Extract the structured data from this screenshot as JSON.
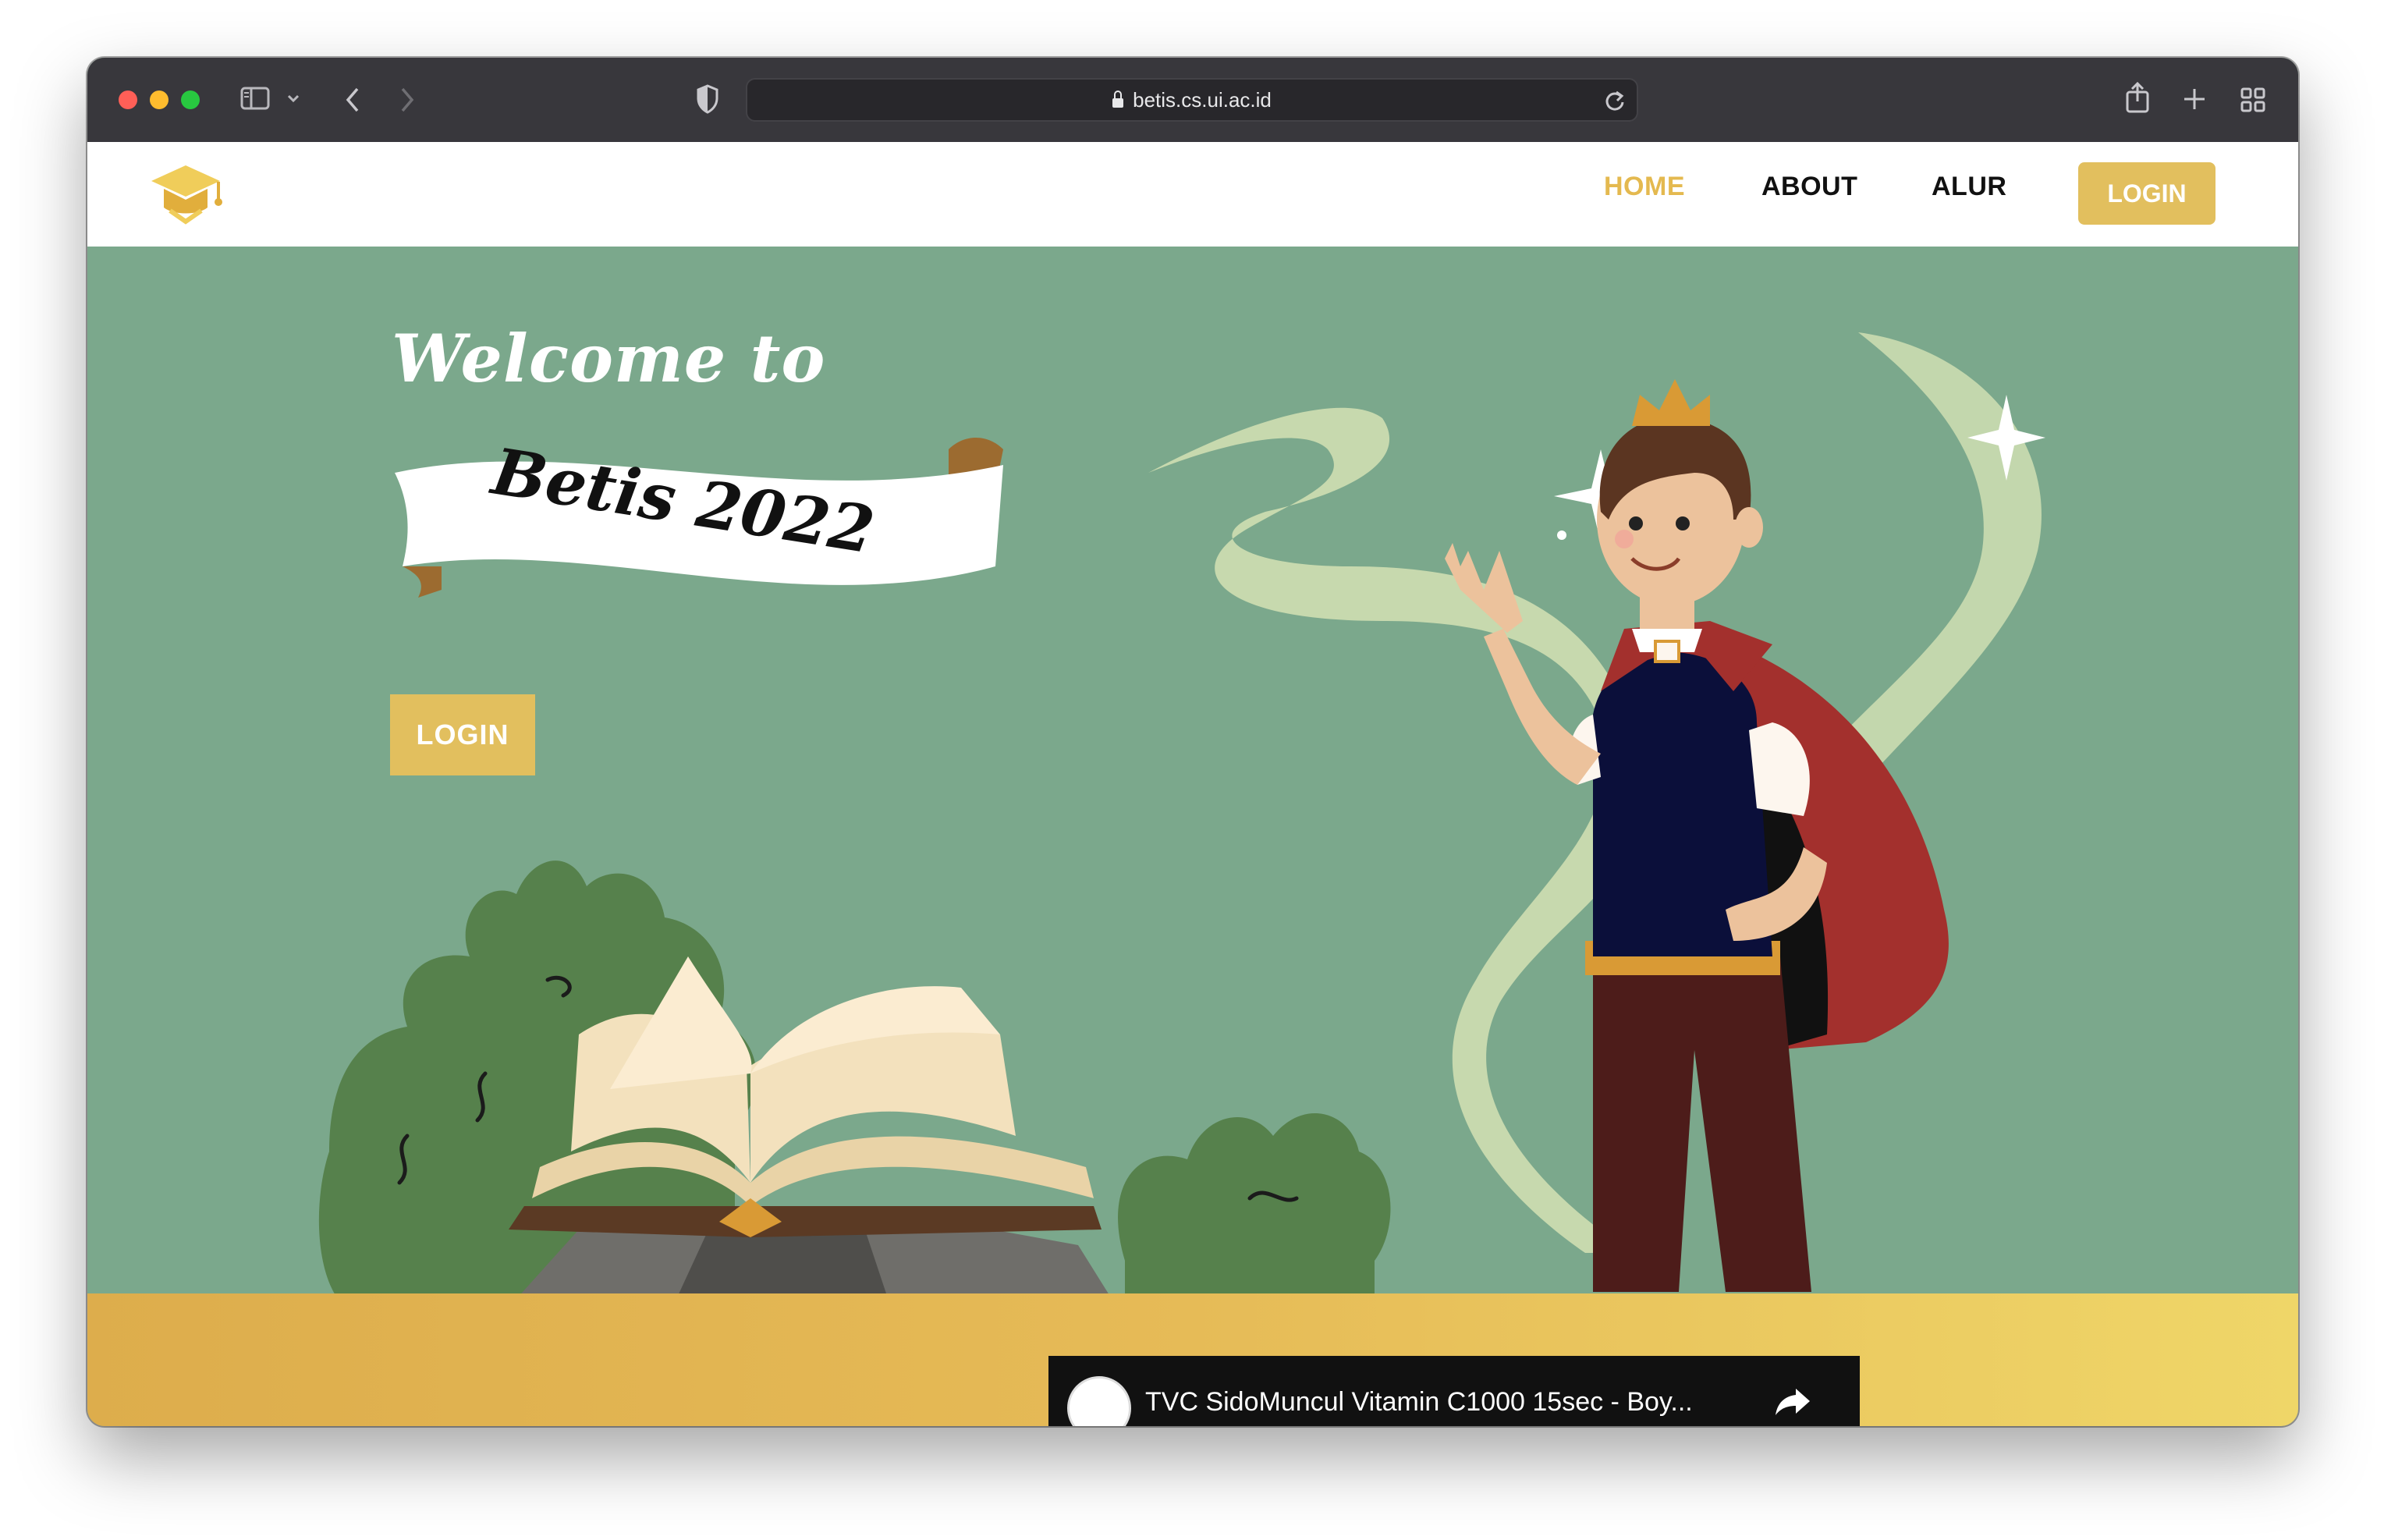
{
  "browser": {
    "url": "betis.cs.ui.ac.id"
  },
  "nav": {
    "home": "HOME",
    "about": "ABOUT",
    "alur": "ALUR",
    "login": "LOGIN"
  },
  "hero": {
    "welcome": "Welcome to",
    "banner": "Betis 2022",
    "login": "LOGIN"
  },
  "video": {
    "title": "TVC SidoMuncul Vitamin C1000 15sec - Boy..."
  },
  "colors": {
    "accent": "#e2bf5e",
    "hero_bg": "#7ba88c",
    "ground": "#e6bb57"
  }
}
